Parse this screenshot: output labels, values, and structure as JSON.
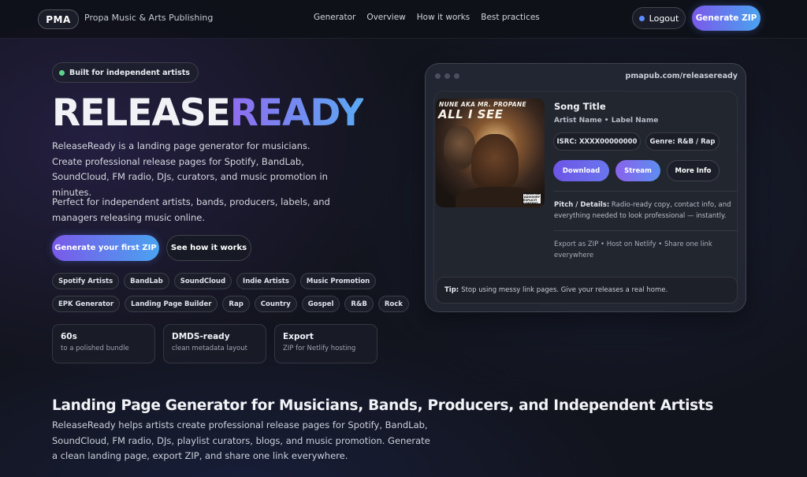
{
  "header": {
    "logo": "PMA",
    "brand_name": "Propa Music & Arts Publishing",
    "nav": [
      {
        "label": "Generator"
      },
      {
        "label": "Overview"
      },
      {
        "label": "How it works"
      },
      {
        "label": "Best practices"
      }
    ],
    "logout_label": "Logout",
    "generate_zip_label": "Generate ZIP",
    "colors": {
      "accent_start": "#7a59ea",
      "accent_end": "#4aa3f0",
      "status_dot": "#5b8cff"
    }
  },
  "hero": {
    "badge": "Built for independent artists",
    "title_part1": "RELEASE",
    "title_part2": "READY",
    "description": "ReleaseReady is a landing page generator for musicians. Create professional release pages for Spotify, BandLab, SoundCloud, FM radio, DJs, curators, and music promotion in minutes.",
    "description2": "Perfect for independent artists, bands, producers, labels, and managers releasing music online.",
    "cta_primary": "Generate your first ZIP",
    "cta_secondary": "See how it works",
    "tags": [
      "Spotify Artists",
      "BandLab",
      "SoundCloud",
      "Indie Artists",
      "Music Promotion",
      "EPK Generator",
      "Landing Page Builder",
      "Rap",
      "Country",
      "Gospel",
      "R&B",
      "Rock"
    ],
    "stats": [
      {
        "title": "60s",
        "sub": "to a polished bundle"
      },
      {
        "title": "DMDS-ready",
        "sub": "clean metadata layout"
      },
      {
        "title": "Export",
        "sub": "ZIP for Netlify hosting"
      }
    ]
  },
  "preview": {
    "url": "pmapub.com/releaseready",
    "album": {
      "artist_text": "NUNE AKA MR. PROPANE",
      "title_text": "ALL I SEE",
      "advisory": [
        "PARENTAL",
        "ADVISORY",
        "EXPLICIT CONTENT"
      ]
    },
    "song_title": "Song Title",
    "artist_line": "Artist Name • Label Name",
    "isrc": "ISRC: XXXX00000000",
    "genre": "Genre: R&B / Rap",
    "buttons": {
      "download": "Download",
      "stream": "Stream",
      "more": "More Info"
    },
    "pitch_label": "Pitch / Details:",
    "pitch_text": " Radio-ready copy, contact info, and everything needed to look professional — instantly.",
    "export_text": "Export as ZIP • Host on Netlify • Share one link everywhere",
    "tip_label": "Tip:",
    "tip_text": "Stop using messy link pages. Give your releases a real home."
  },
  "section": {
    "title": "Landing Page Generator for Musicians, Bands, Producers, and Independent Artists",
    "description": "ReleaseReady helps artists create professional release pages for Spotify, BandLab, SoundCloud, FM radio, DJs, playlist curators, blogs, and music promotion. Generate a clean landing page, export ZIP, and share one link everywhere."
  }
}
